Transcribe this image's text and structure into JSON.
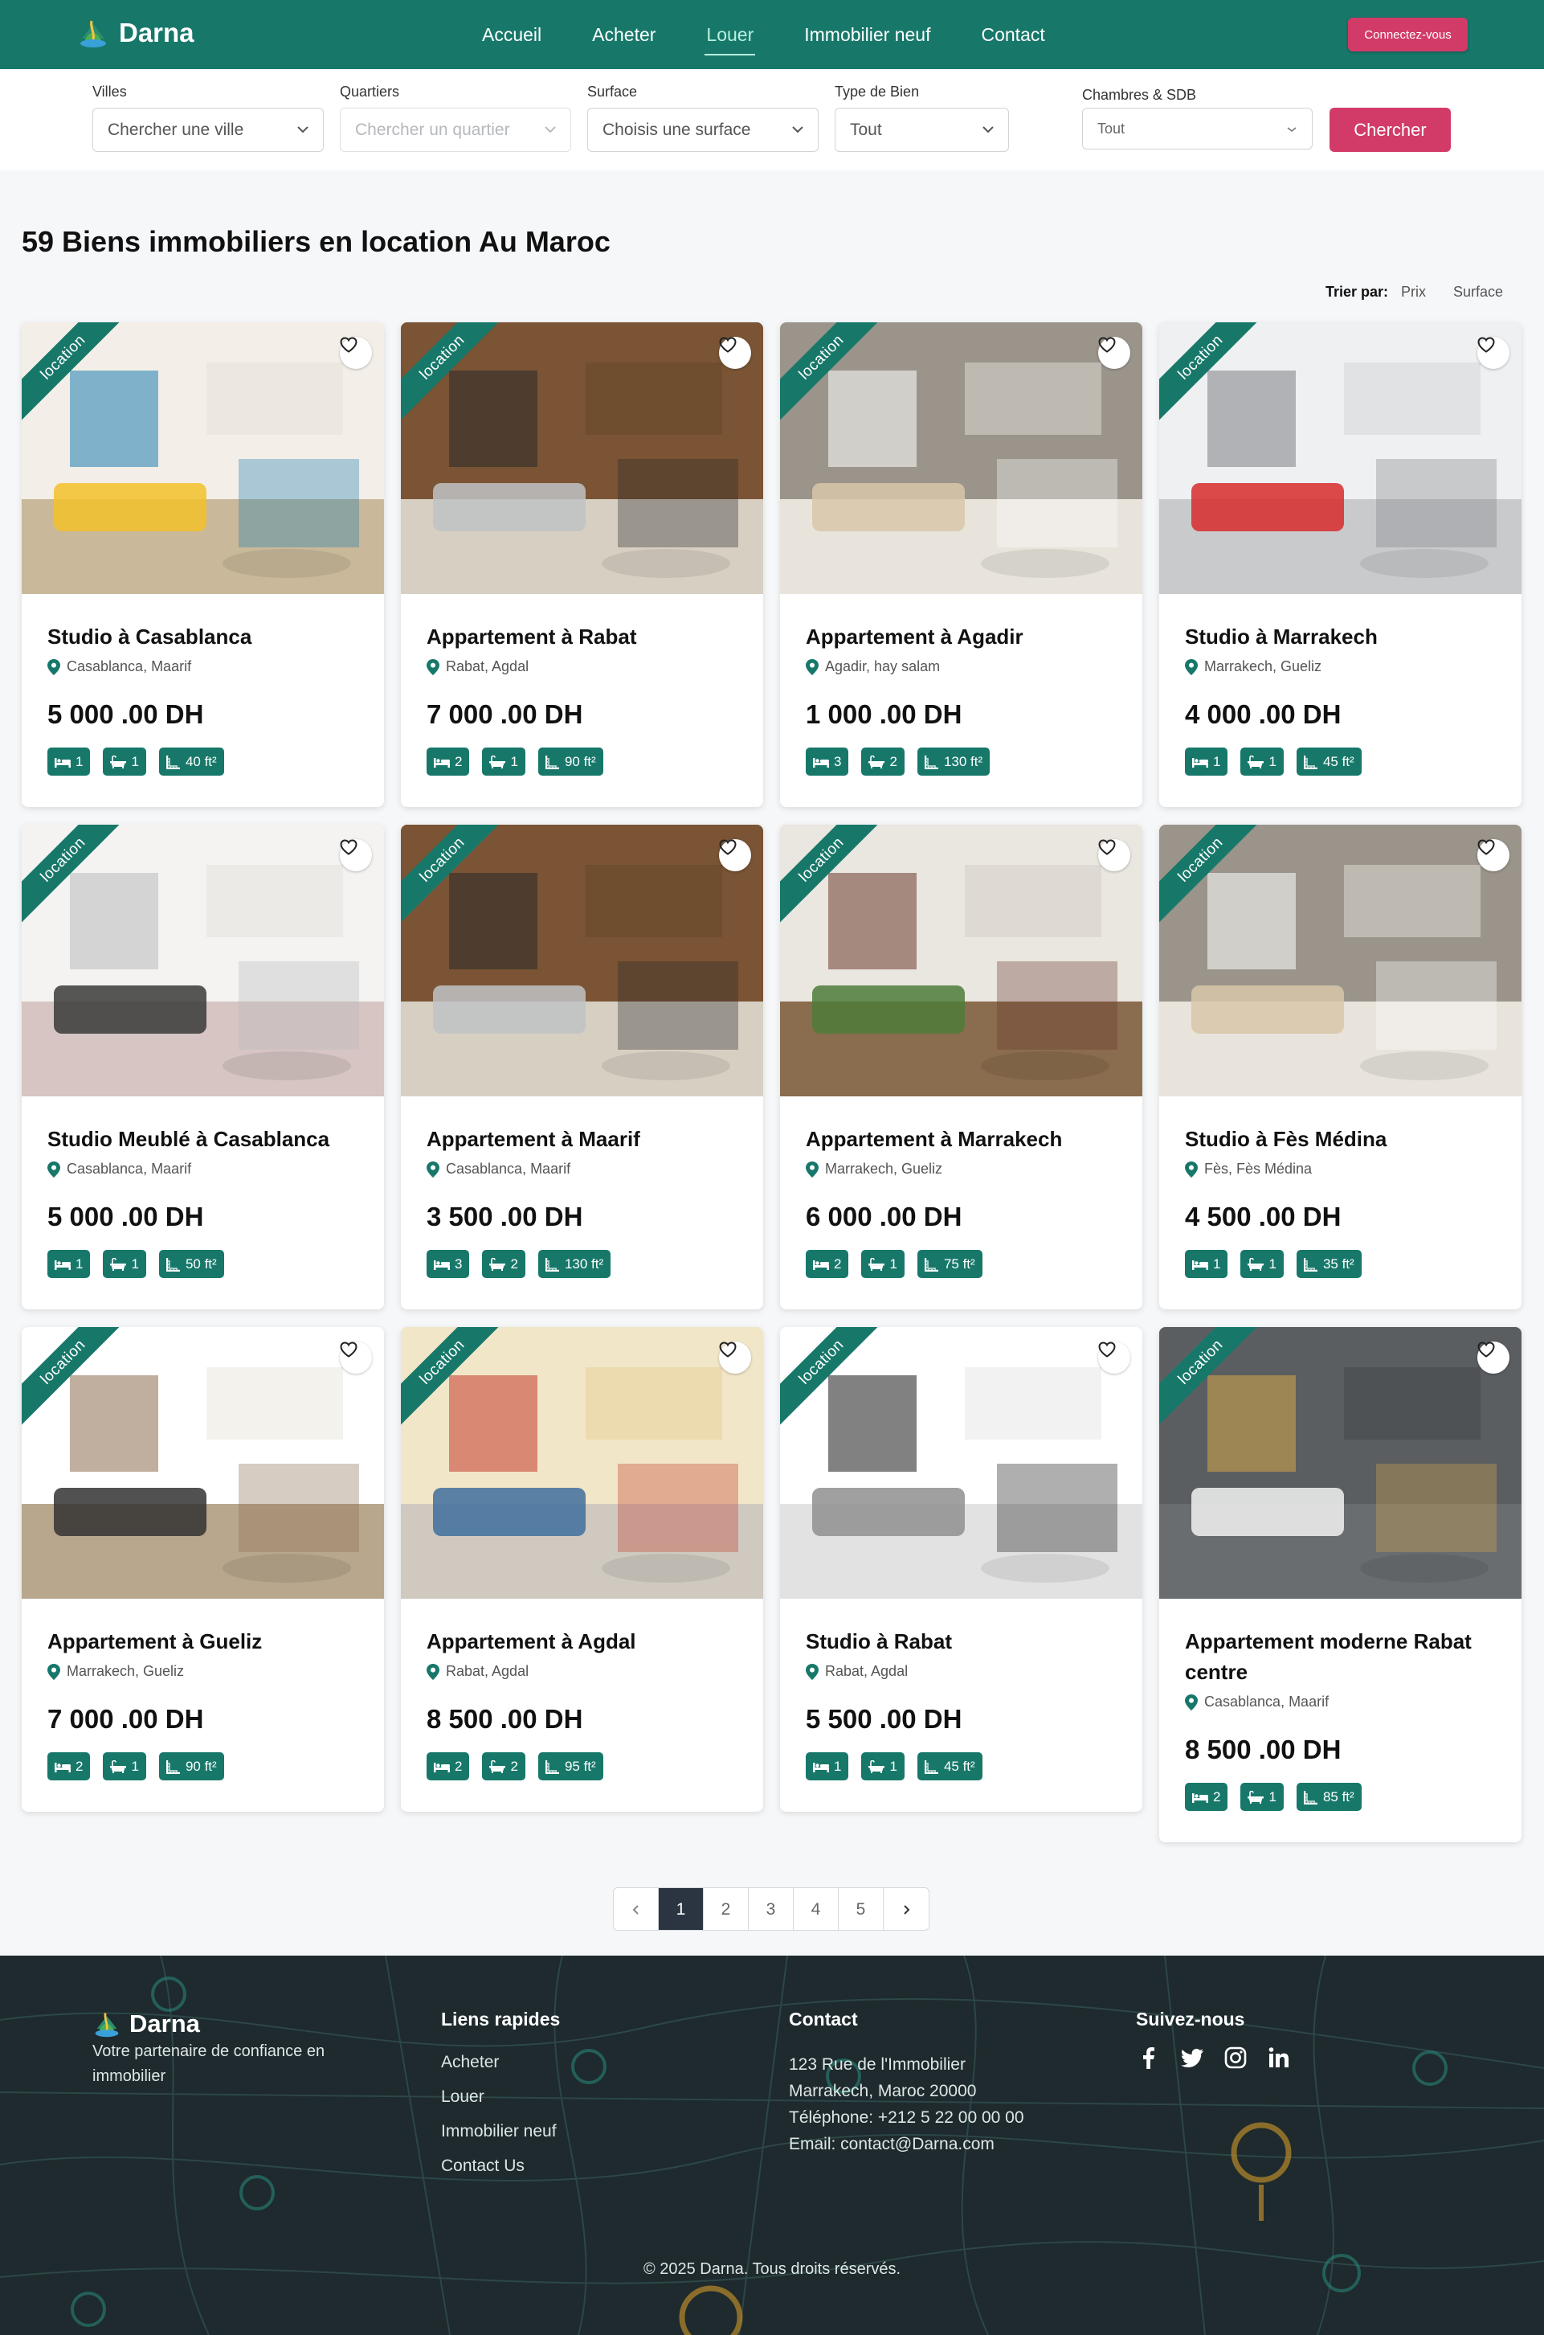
{
  "nav": {
    "brand": "Darna",
    "items": [
      {
        "label": "Accueil",
        "active": false
      },
      {
        "label": "Acheter",
        "active": false
      },
      {
        "label": "Louer",
        "active": true
      },
      {
        "label": "Immobilier neuf",
        "active": false
      },
      {
        "label": "Contact",
        "active": false
      }
    ],
    "login": "Connectez-vous"
  },
  "filters": {
    "villes": {
      "label": "Villes",
      "placeholder": "Chercher une ville"
    },
    "quartiers": {
      "label": "Quartiers",
      "placeholder": "Chercher un quartier"
    },
    "surface": {
      "label": "Surface",
      "placeholder": "Choisis une surface"
    },
    "type": {
      "label": "Type de Bien",
      "value": "Tout"
    },
    "chambres": {
      "label": "Chambres & SDB",
      "value": "Tout"
    },
    "search": "Chercher"
  },
  "page": {
    "title": "59 Biens immobiliers en location Au Maroc",
    "sort_label": "Trier par:",
    "sort_options": [
      "Prix",
      "Surface"
    ]
  },
  "ribbon": "location",
  "listings": [
    {
      "title": "Studio à Casablanca",
      "location": "Casablanca, Maarif",
      "price": "5 000 .00 DH",
      "beds": "1",
      "baths": "1",
      "area": "40 ft²"
    },
    {
      "title": "Appartement à Rabat",
      "location": "Rabat, Agdal",
      "price": "7 000 .00 DH",
      "beds": "2",
      "baths": "1",
      "area": "90 ft²"
    },
    {
      "title": "Appartement à Agadir",
      "location": "Agadir, hay salam",
      "price": "1 000 .00 DH",
      "beds": "3",
      "baths": "2",
      "area": "130 ft²"
    },
    {
      "title": "Studio à Marrakech",
      "location": "Marrakech, Gueliz",
      "price": "4 000 .00 DH",
      "beds": "1",
      "baths": "1",
      "area": "45 ft²"
    },
    {
      "title": "Studio Meublé à Casablanca",
      "location": "Casablanca, Maarif",
      "price": "5 000 .00 DH",
      "beds": "1",
      "baths": "1",
      "area": "50 ft²"
    },
    {
      "title": "Appartement à Maarif",
      "location": "Casablanca, Maarif",
      "price": "3 500 .00 DH",
      "beds": "3",
      "baths": "2",
      "area": "130 ft²"
    },
    {
      "title": "Appartement à Marrakech",
      "location": "Marrakech, Gueliz",
      "price": "6 000 .00 DH",
      "beds": "2",
      "baths": "1",
      "area": "75 ft²"
    },
    {
      "title": "Studio à Fès Médina",
      "location": "Fès, Fès Médina",
      "price": "4 500 .00 DH",
      "beds": "1",
      "baths": "1",
      "area": "35 ft²"
    },
    {
      "title": "Appartement à Gueliz",
      "location": "Marrakech, Gueliz",
      "price": "7 000 .00 DH",
      "beds": "2",
      "baths": "1",
      "area": "90 ft²"
    },
    {
      "title": "Appartement à Agdal",
      "location": "Rabat, Agdal",
      "price": "8 500 .00 DH",
      "beds": "2",
      "baths": "2",
      "area": "95 ft²"
    },
    {
      "title": "Studio à Rabat",
      "location": "Rabat, Agdal",
      "price": "5 500 .00 DH",
      "beds": "1",
      "baths": "1",
      "area": "45 ft²"
    },
    {
      "title": "Appartement moderne Rabat centre",
      "location": "Casablanca, Maarif",
      "price": "8 500 .00 DH",
      "beds": "2",
      "baths": "1",
      "area": "85 ft²"
    }
  ],
  "pagination": {
    "pages": [
      "1",
      "2",
      "3",
      "4",
      "5"
    ],
    "current": "1"
  },
  "footer": {
    "brand": "Darna",
    "tagline": "Votre partenaire de confiance en immobilier",
    "links_title": "Liens rapides",
    "links": [
      "Acheter",
      "Louer",
      "Immobilier neuf",
      "Contact Us"
    ],
    "contact_title": "Contact",
    "contact": [
      "123 Rue de l'Immobilier",
      "Marrakech, Maroc 20000",
      "Téléphone: +212 5 22 00 00 00",
      "Email: contact@Darna.com"
    ],
    "social_title": "Suivez-nous",
    "socials": [
      "facebook-icon",
      "twitter-icon",
      "instagram-icon",
      "linkedin-icon"
    ],
    "copyright": "© 2025 Darna. Tous droits réservés."
  },
  "colors": {
    "primary": "#17786a",
    "accent": "#d23b68",
    "footer": "#1e2a2d"
  }
}
